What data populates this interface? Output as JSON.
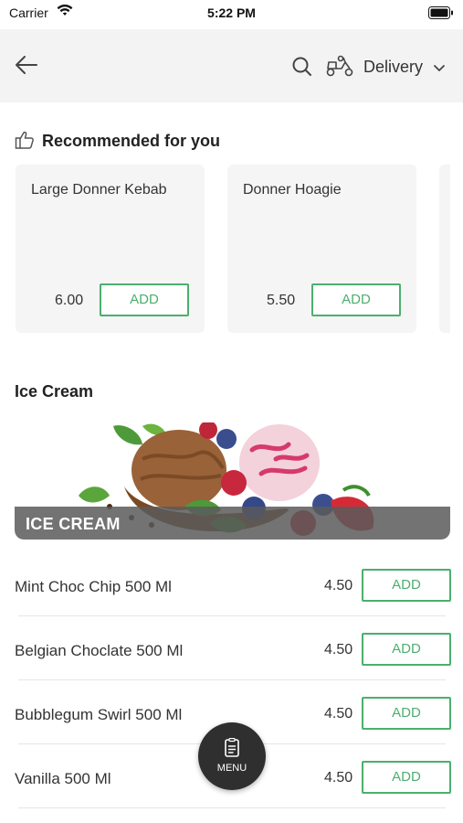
{
  "status_bar": {
    "carrier": "Carrier",
    "time": "5:22 PM"
  },
  "header": {
    "delivery_label": "Delivery"
  },
  "recommended": {
    "title": "Recommended for you",
    "items": [
      {
        "name": "Large Donner Kebab",
        "price": "6.00",
        "add_label": "ADD"
      },
      {
        "name": "Donner Hoagie",
        "price": "5.50",
        "add_label": "ADD"
      }
    ]
  },
  "section": {
    "title": "Ice Cream",
    "banner_label": "ICE CREAM",
    "items": [
      {
        "name": "Mint Choc Chip 500 Ml",
        "price": "4.50",
        "add_label": "ADD"
      },
      {
        "name": "Belgian Choclate 500 Ml",
        "price": "4.50",
        "add_label": "ADD"
      },
      {
        "name": "Bubblegum Swirl 500 Ml",
        "price": "4.50",
        "add_label": "ADD"
      },
      {
        "name": "Vanilla 500 Ml",
        "price": "4.50",
        "add_label": "ADD"
      }
    ]
  },
  "menu_fab": {
    "label": "MENU"
  },
  "colors": {
    "accent_green": "#4caf6e",
    "header_bg": "#f3f3f3",
    "card_bg": "#f5f5f5",
    "fab_bg": "#2f2f2f"
  },
  "icons": [
    "wifi-icon",
    "battery-icon",
    "back-arrow-icon",
    "search-icon",
    "scooter-icon",
    "chevron-down-icon",
    "thumbs-up-icon",
    "menu-icon"
  ]
}
